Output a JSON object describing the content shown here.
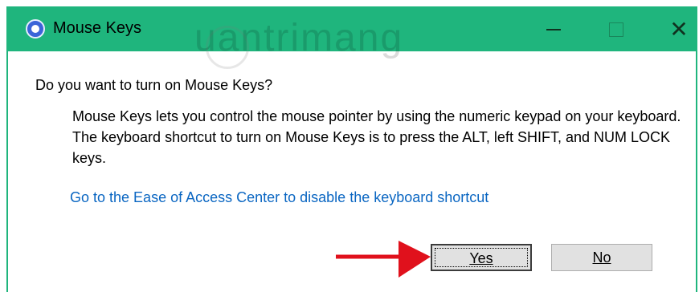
{
  "window": {
    "title": "Mouse Keys",
    "controls": {
      "minimize": "minimize",
      "maximize": "maximize",
      "close": "✕"
    },
    "accent_color": "#1fb57d"
  },
  "dialog": {
    "question": "Do you want to turn on Mouse Keys?",
    "description": "Mouse Keys lets you control the mouse pointer by using the numeric keypad on your keyboard.  The keyboard shortcut to turn on Mouse Keys is to press the ALT, left SHIFT, and NUM LOCK keys.",
    "link": "Go to the Ease of Access Center to disable the keyboard shortcut",
    "buttons": {
      "yes": "Yes",
      "no": "No"
    }
  },
  "watermark": {
    "text": "uantrimang"
  },
  "annotations": {
    "arrow_color": "#e0111c"
  }
}
